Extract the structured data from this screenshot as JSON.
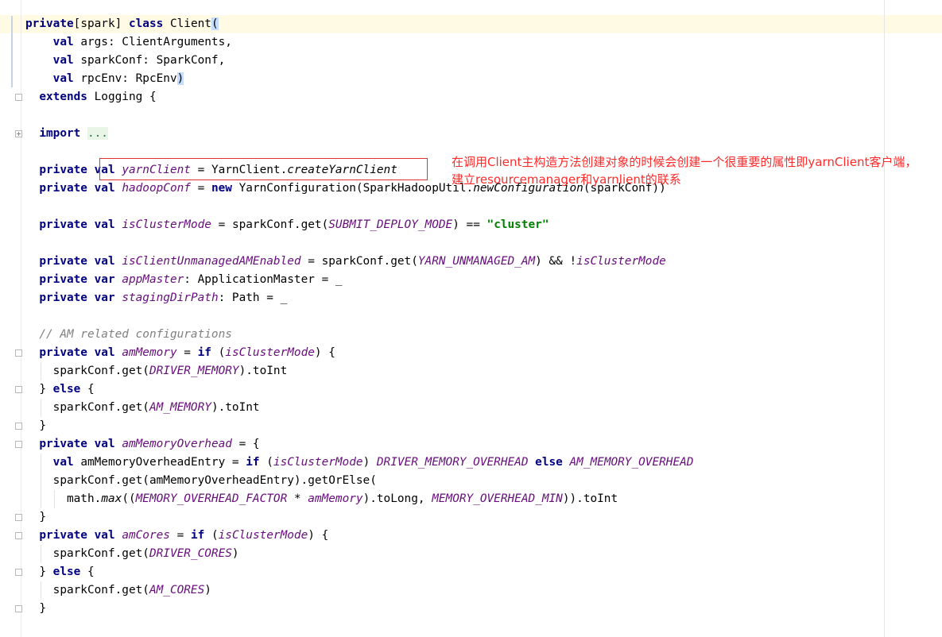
{
  "editor": {
    "lines": [
      [
        {
          "t": "private",
          "c": "kw"
        },
        {
          "t": "[spark] "
        },
        {
          "t": "class",
          "c": "kw"
        },
        {
          "t": " Client"
        },
        {
          "t": "(",
          "c": "paren-match"
        }
      ],
      [
        {
          "t": "    "
        },
        {
          "t": "val",
          "c": "kw"
        },
        {
          "t": " args: ClientArguments,"
        }
      ],
      [
        {
          "t": "    "
        },
        {
          "t": "val",
          "c": "kw"
        },
        {
          "t": " sparkConf: SparkConf,"
        }
      ],
      [
        {
          "t": "    "
        },
        {
          "t": "val",
          "c": "kw"
        },
        {
          "t": " rpcEnv: RpcEnv"
        },
        {
          "t": ")",
          "c": "paren-match"
        }
      ],
      [
        {
          "t": "  "
        },
        {
          "t": "extends",
          "c": "kw"
        },
        {
          "t": " Logging {"
        }
      ],
      [],
      [
        {
          "t": "  "
        },
        {
          "t": "import",
          "c": "kw"
        },
        {
          "t": " "
        },
        {
          "t": "...",
          "c": "fold-placeholder"
        }
      ],
      [],
      [
        {
          "t": "  "
        },
        {
          "t": "private val",
          "c": "kw"
        },
        {
          "t": " "
        },
        {
          "t": "yarnClient",
          "c": "field"
        },
        {
          "t": " = YarnClient."
        },
        {
          "t": "createYarnClient",
          "c": "mcall"
        }
      ],
      [
        {
          "t": "  "
        },
        {
          "t": "private val",
          "c": "kw"
        },
        {
          "t": " "
        },
        {
          "t": "hadoopConf",
          "c": "field"
        },
        {
          "t": " = "
        },
        {
          "t": "new",
          "c": "kw"
        },
        {
          "t": " YarnConfiguration(SparkHadoopUtil."
        },
        {
          "t": "newConfiguration",
          "c": "mcall"
        },
        {
          "t": "(sparkConf))"
        }
      ],
      [],
      [
        {
          "t": "  "
        },
        {
          "t": "private val",
          "c": "kw"
        },
        {
          "t": " "
        },
        {
          "t": "isClusterMode",
          "c": "field"
        },
        {
          "t": " = sparkConf.get("
        },
        {
          "t": "SUBMIT_DEPLOY_MODE",
          "c": "static"
        },
        {
          "t": ") == "
        },
        {
          "t": "\"cluster\"",
          "c": "str"
        }
      ],
      [],
      [
        {
          "t": "  "
        },
        {
          "t": "private val",
          "c": "kw"
        },
        {
          "t": " "
        },
        {
          "t": "isClientUnmanagedAMEnabled",
          "c": "field"
        },
        {
          "t": " = sparkConf.get("
        },
        {
          "t": "YARN_UNMANAGED_AM",
          "c": "static"
        },
        {
          "t": ") && !"
        },
        {
          "t": "isClusterMode",
          "c": "field"
        }
      ],
      [
        {
          "t": "  "
        },
        {
          "t": "private var",
          "c": "kw"
        },
        {
          "t": " "
        },
        {
          "t": "appMaster",
          "c": "field"
        },
        {
          "t": ": ApplicationMaster = _"
        }
      ],
      [
        {
          "t": "  "
        },
        {
          "t": "private var",
          "c": "kw"
        },
        {
          "t": " "
        },
        {
          "t": "stagingDirPath",
          "c": "field"
        },
        {
          "t": ": Path = _"
        }
      ],
      [],
      [
        {
          "t": "  "
        },
        {
          "t": "// AM related configurations",
          "c": "cmt"
        }
      ],
      [
        {
          "t": "  "
        },
        {
          "t": "private val",
          "c": "kw"
        },
        {
          "t": " "
        },
        {
          "t": "amMemory",
          "c": "field"
        },
        {
          "t": " = "
        },
        {
          "t": "if",
          "c": "kw"
        },
        {
          "t": " ("
        },
        {
          "t": "isClusterMode",
          "c": "field"
        },
        {
          "t": ") {"
        }
      ],
      [
        {
          "t": "    sparkConf.get("
        },
        {
          "t": "DRIVER_MEMORY",
          "c": "static"
        },
        {
          "t": ").toInt"
        }
      ],
      [
        {
          "t": "  } "
        },
        {
          "t": "else",
          "c": "kw"
        },
        {
          "t": " {"
        }
      ],
      [
        {
          "t": "    sparkConf.get("
        },
        {
          "t": "AM_MEMORY",
          "c": "static"
        },
        {
          "t": ").toInt"
        }
      ],
      [
        {
          "t": "  }"
        }
      ],
      [
        {
          "t": "  "
        },
        {
          "t": "private val",
          "c": "kw"
        },
        {
          "t": " "
        },
        {
          "t": "amMemoryOverhead",
          "c": "field"
        },
        {
          "t": " = {"
        }
      ],
      [
        {
          "t": "    "
        },
        {
          "t": "val",
          "c": "kw"
        },
        {
          "t": " amMemoryOverheadEntry = "
        },
        {
          "t": "if",
          "c": "kw"
        },
        {
          "t": " ("
        },
        {
          "t": "isClusterMode",
          "c": "field"
        },
        {
          "t": ") "
        },
        {
          "t": "DRIVER_MEMORY_OVERHEAD",
          "c": "static"
        },
        {
          "t": " "
        },
        {
          "t": "else",
          "c": "kw"
        },
        {
          "t": " "
        },
        {
          "t": "AM_MEMORY_OVERHEAD",
          "c": "static"
        }
      ],
      [
        {
          "t": "    sparkConf.get(amMemoryOverheadEntry).getOrElse("
        }
      ],
      [
        {
          "t": "      math."
        },
        {
          "t": "max",
          "c": "mcall"
        },
        {
          "t": "(("
        },
        {
          "t": "MEMORY_OVERHEAD_FACTOR",
          "c": "static"
        },
        {
          "t": " * "
        },
        {
          "t": "amMemory",
          "c": "field"
        },
        {
          "t": ").toLong, "
        },
        {
          "t": "MEMORY_OVERHEAD_MIN",
          "c": "static"
        },
        {
          "t": ")).toInt"
        }
      ],
      [
        {
          "t": "  }"
        }
      ],
      [
        {
          "t": "  "
        },
        {
          "t": "private val",
          "c": "kw"
        },
        {
          "t": " "
        },
        {
          "t": "amCores",
          "c": "field"
        },
        {
          "t": " = "
        },
        {
          "t": "if",
          "c": "kw"
        },
        {
          "t": " ("
        },
        {
          "t": "isClusterMode",
          "c": "field"
        },
        {
          "t": ") {"
        }
      ],
      [
        {
          "t": "    sparkConf.get("
        },
        {
          "t": "DRIVER_CORES",
          "c": "static"
        },
        {
          "t": ")"
        }
      ],
      [
        {
          "t": "  } "
        },
        {
          "t": "else",
          "c": "kw"
        },
        {
          "t": " {"
        }
      ],
      [
        {
          "t": "    sparkConf.get("
        },
        {
          "t": "AM_CORES",
          "c": "static"
        },
        {
          "t": ")"
        }
      ],
      [
        {
          "t": "  }"
        }
      ]
    ]
  },
  "annotation": {
    "text": "在调用Client主构造方法创建对象的时候会创建一个很重要的属性即yarnClient客户端，建立resourcemanager和yarnlient的联系",
    "color": "#ff2a2a"
  },
  "fold_markers": [
    {
      "line": 4,
      "kind": "end"
    },
    {
      "line": 6,
      "kind": "plus"
    },
    {
      "line": 18,
      "kind": "start"
    },
    {
      "line": 20,
      "kind": "mid"
    },
    {
      "line": 22,
      "kind": "end"
    },
    {
      "line": 23,
      "kind": "start"
    },
    {
      "line": 27,
      "kind": "end"
    },
    {
      "line": 28,
      "kind": "start"
    },
    {
      "line": 30,
      "kind": "mid"
    },
    {
      "line": 32,
      "kind": "end"
    }
  ]
}
